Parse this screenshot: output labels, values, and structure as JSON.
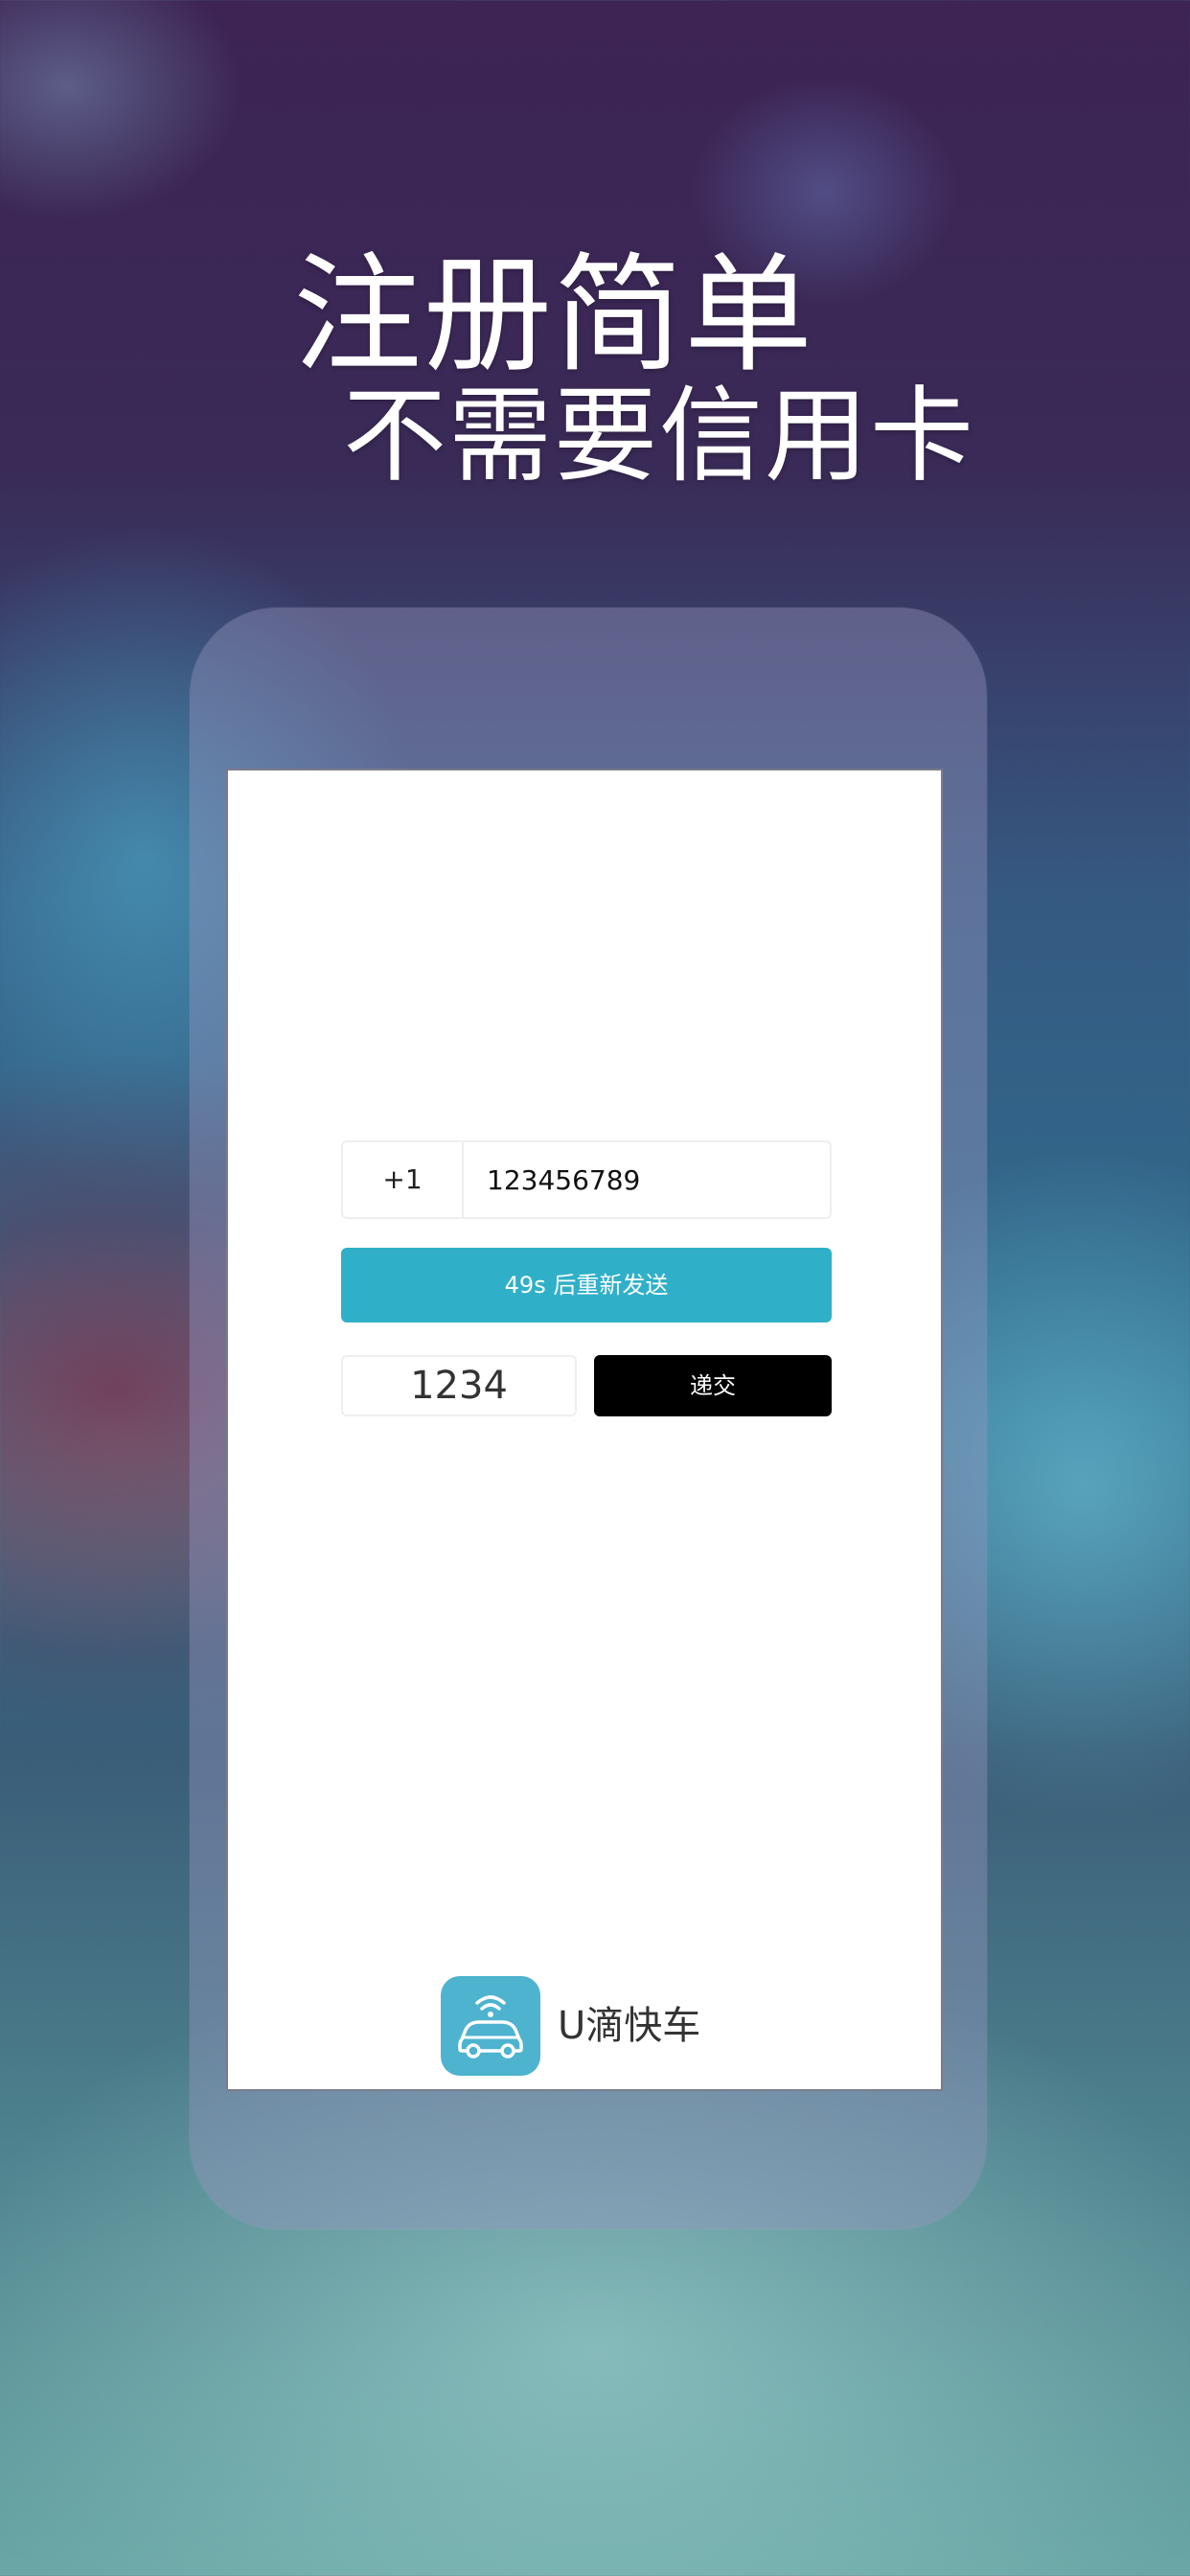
{
  "headline": {
    "line1": "注册简单",
    "line2": "不需要信用卡"
  },
  "form": {
    "country_code": "+1",
    "phone_value": "123456789",
    "resend_label": "49s 后重新发送",
    "code_value": "1234",
    "submit_label": "递交"
  },
  "brand": {
    "app_name": "U滴快车",
    "icon": "car-wifi-icon"
  },
  "colors": {
    "accent": "#2fb0c8",
    "submit": "#000000",
    "icon_bg": "#4db3cf"
  }
}
